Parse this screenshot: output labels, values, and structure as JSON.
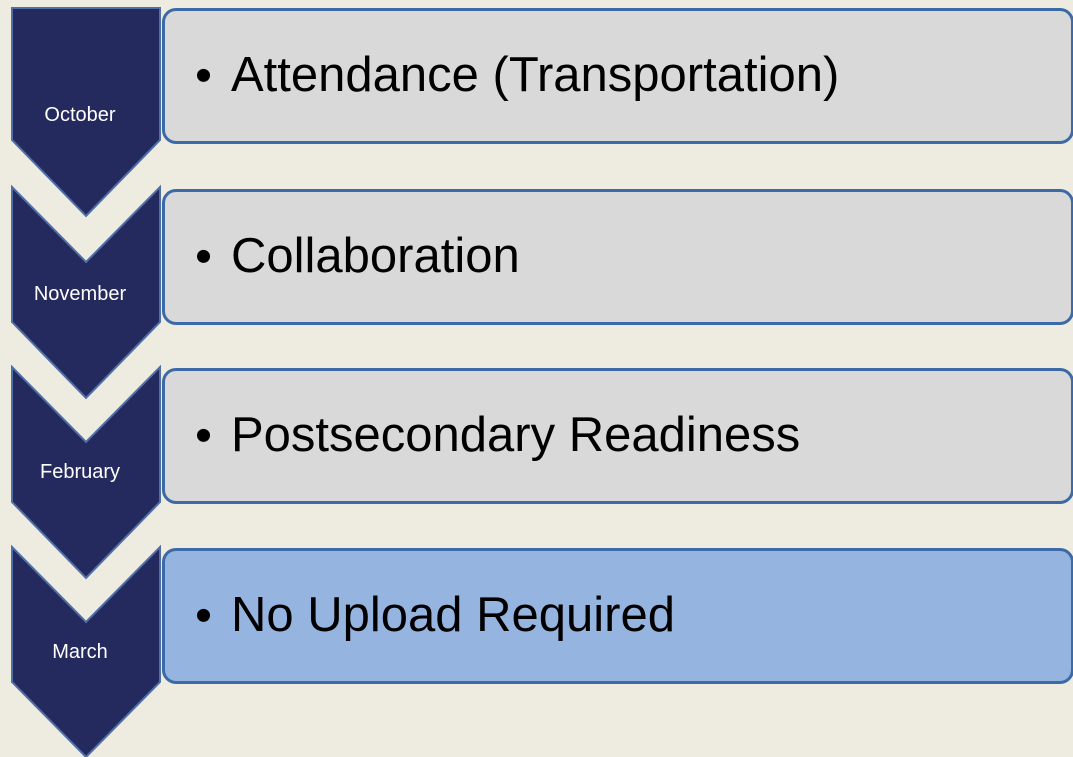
{
  "colors": {
    "background": "#eeece1",
    "chevron_fill": "#252a5e",
    "chevron_stroke": "#4f6fa6",
    "box_gray": "#d9d9d9",
    "box_blue": "#95b5e0",
    "box_border": "#3c6aa6"
  },
  "steps": [
    {
      "month": "October",
      "item": "Attendance (Transportation)"
    },
    {
      "month": "November",
      "item": "Collaboration"
    },
    {
      "month": "February",
      "item": "Postsecondary Readiness"
    },
    {
      "month": "March",
      "item": "No Upload Required"
    }
  ]
}
